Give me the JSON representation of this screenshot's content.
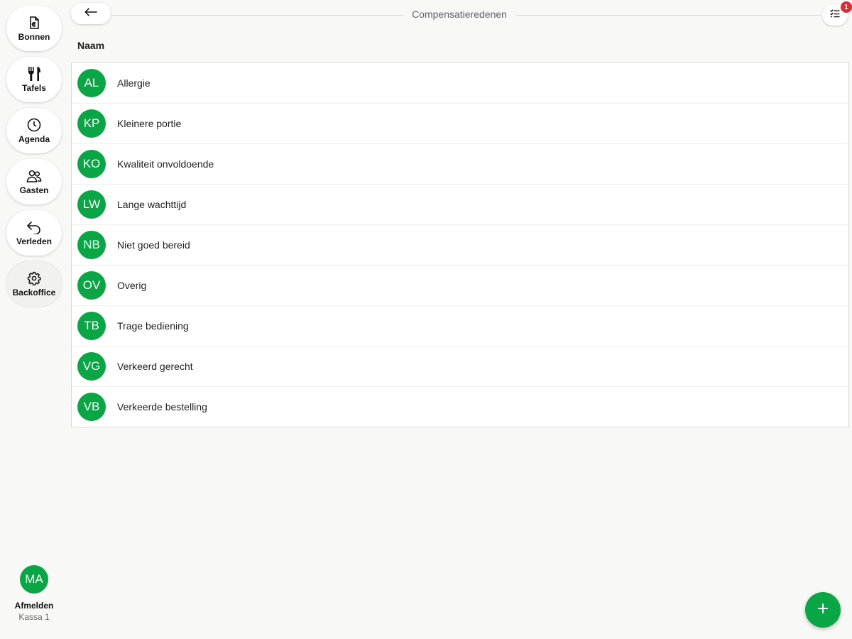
{
  "nav": [
    {
      "label": "Bonnen",
      "icon": "receipt-euro-icon"
    },
    {
      "label": "Tafels",
      "icon": "cutlery-icon"
    },
    {
      "label": "Agenda",
      "icon": "clock-icon"
    },
    {
      "label": "Gasten",
      "icon": "users-icon"
    },
    {
      "label": "Verleden",
      "icon": "undo-arrow-icon"
    },
    {
      "label": "Backoffice",
      "icon": "gear-icon",
      "active": true
    }
  ],
  "user": {
    "initials": "MA",
    "logout_label": "Afmelden",
    "station": "Kassa 1"
  },
  "header": {
    "title": "Compensatieredenen",
    "back_icon": "arrow-left-icon",
    "tasks_icon": "checklist-icon",
    "badge_count": "1"
  },
  "table": {
    "column_header": "Naam",
    "rows": [
      {
        "initials": "AL",
        "name": "Allergie"
      },
      {
        "initials": "KP",
        "name": "Kleinere portie"
      },
      {
        "initials": "KO",
        "name": "Kwaliteit onvoldoende"
      },
      {
        "initials": "LW",
        "name": "Lange wachttijd"
      },
      {
        "initials": "NB",
        "name": "Niet goed bereid"
      },
      {
        "initials": "OV",
        "name": "Overig"
      },
      {
        "initials": "TB",
        "name": "Trage bediening"
      },
      {
        "initials": "VG",
        "name": "Verkeerd gerecht"
      },
      {
        "initials": "VB",
        "name": "Verkeerde bestelling"
      }
    ]
  },
  "fab": {
    "icon": "plus-icon"
  },
  "colors": {
    "accent": "#0aa645",
    "badge": "#e5272f",
    "background": "#f8f8f7"
  }
}
